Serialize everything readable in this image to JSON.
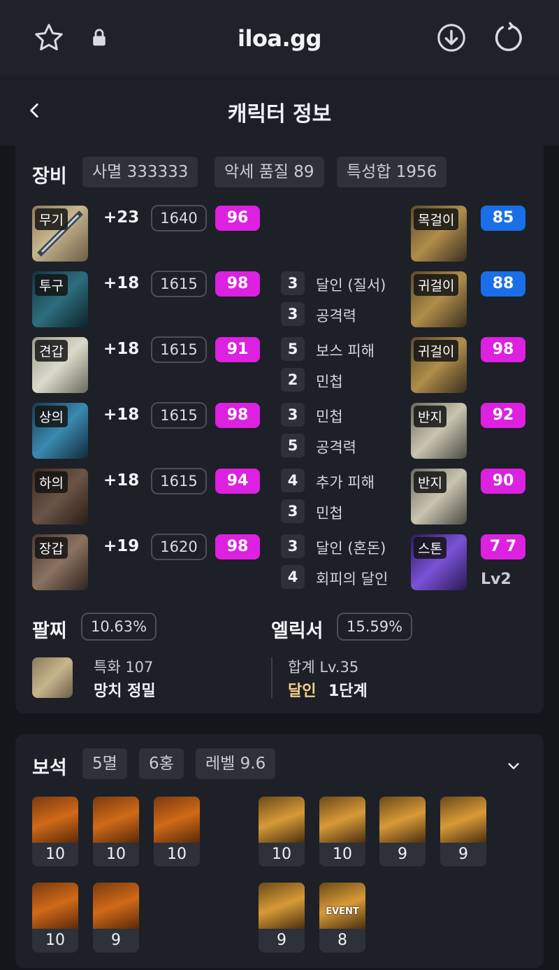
{
  "browser": {
    "url": "iloa.gg"
  },
  "header": {
    "title": "캐릭터 정보"
  },
  "equipment": {
    "title": "장비",
    "chips": [
      "사멸 333333",
      "악세 품질 89",
      "특성합 1956"
    ],
    "gear": [
      {
        "slot": "무기",
        "honing": "+23",
        "ilvl": "1640",
        "quality": "96"
      },
      {
        "slot": "투구",
        "honing": "+18",
        "ilvl": "1615",
        "quality": "98"
      },
      {
        "slot": "견갑",
        "honing": "+18",
        "ilvl": "1615",
        "quality": "91"
      },
      {
        "slot": "상의",
        "honing": "+18",
        "ilvl": "1615",
        "quality": "98"
      },
      {
        "slot": "하의",
        "honing": "+18",
        "ilvl": "1615",
        "quality": "94"
      },
      {
        "slot": "장갑",
        "honing": "+19",
        "ilvl": "1620",
        "quality": "98"
      }
    ],
    "engravings": [
      {
        "num": "3",
        "name": "달인 (질서)"
      },
      {
        "num": "3",
        "name": "공격력"
      },
      {
        "num": "5",
        "name": "보스 피해"
      },
      {
        "num": "2",
        "name": "민첩"
      },
      {
        "num": "3",
        "name": "민첩"
      },
      {
        "num": "5",
        "name": "공격력"
      },
      {
        "num": "4",
        "name": "추가 피해"
      },
      {
        "num": "3",
        "name": "민첩"
      },
      {
        "num": "3",
        "name": "달인 (혼돈)"
      },
      {
        "num": "4",
        "name": "회피의 달인"
      }
    ],
    "accessories": [
      {
        "slot": "목걸이",
        "quality": "85",
        "color": "#1a6fe8"
      },
      {
        "slot": "귀걸이",
        "quality": "88",
        "color": "#1a6fe8"
      },
      {
        "slot": "귀걸이",
        "quality": "98",
        "color": "#dc21e0"
      },
      {
        "slot": "반지",
        "quality": "92",
        "color": "#dc21e0"
      },
      {
        "slot": "반지",
        "quality": "90",
        "color": "#dc21e0"
      },
      {
        "slot": "스톤",
        "quality": "7 7",
        "color": "#dc21e0"
      }
    ],
    "stone_level": "Lv2",
    "bracelet": {
      "title": "팔찌",
      "pct": "10.63%",
      "line1": "특화 107",
      "line2": "망치  정밀"
    },
    "elixir": {
      "title": "엘릭서",
      "pct": "15.59%",
      "line1": "합계 Lv.35",
      "line2a": "달인",
      "line2b": "1단계"
    }
  },
  "gems": {
    "title": "보석",
    "chips": [
      "5멸",
      "6홍",
      "레벨 9.6"
    ],
    "items": [
      {
        "level": "10",
        "type": "멸"
      },
      {
        "level": "10",
        "type": "멸"
      },
      {
        "level": "10",
        "type": "멸"
      },
      {
        "level": "10",
        "type": "홍"
      },
      {
        "level": "10",
        "type": "홍"
      },
      {
        "level": "9",
        "type": "홍"
      },
      {
        "level": "9",
        "type": "홍"
      },
      {
        "level": "10",
        "type": "멸"
      },
      {
        "level": "9",
        "type": "멸"
      },
      {
        "level": "9",
        "type": "홍"
      },
      {
        "level": "8",
        "type": "홍",
        "badge": "EVENT"
      }
    ]
  }
}
